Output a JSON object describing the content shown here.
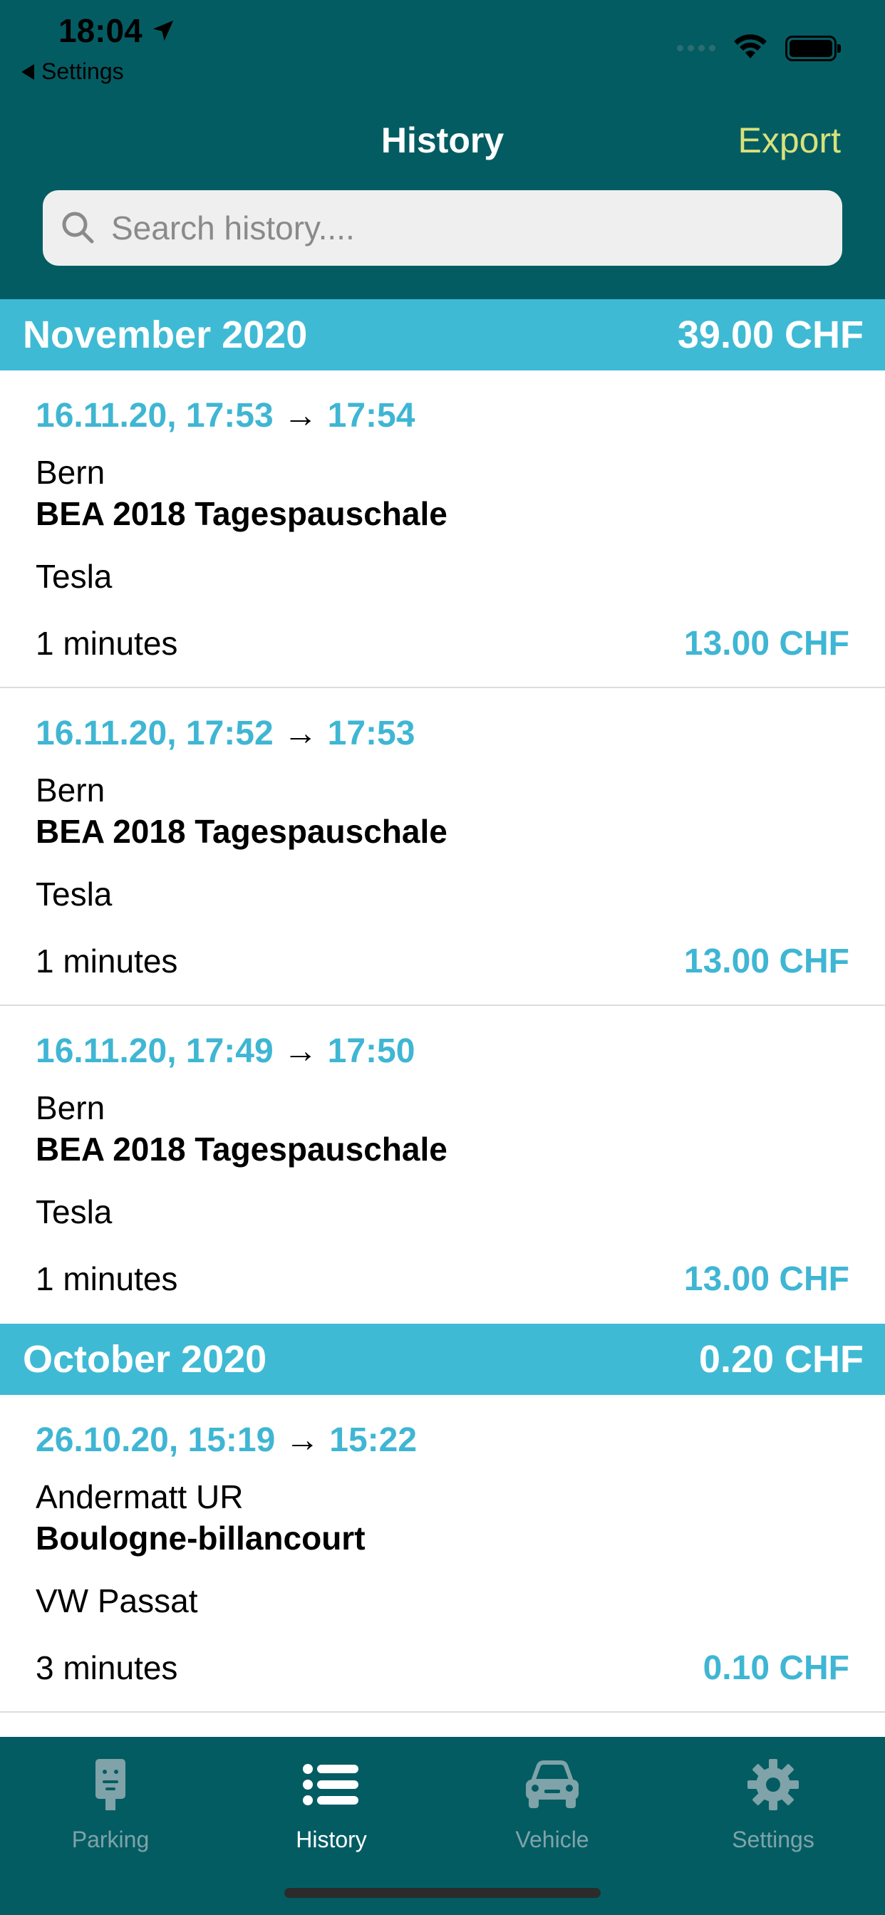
{
  "status": {
    "time": "18:04"
  },
  "back_link": {
    "label": "Settings"
  },
  "nav": {
    "title": "History",
    "export_label": "Export"
  },
  "search": {
    "placeholder": "Search history...."
  },
  "sections": [
    {
      "month": "November 2020",
      "total": "39.00 CHF",
      "entries": [
        {
          "start": "16.11.20, 17:53",
          "end": "17:54",
          "city": "Bern",
          "tariff": "BEA 2018 Tagespauschale",
          "vehicle": "Tesla",
          "duration": "1 minutes",
          "price": "13.00 CHF"
        },
        {
          "start": "16.11.20, 17:52",
          "end": "17:53",
          "city": "Bern",
          "tariff": "BEA 2018 Tagespauschale",
          "vehicle": "Tesla",
          "duration": "1 minutes",
          "price": "13.00 CHF"
        },
        {
          "start": "16.11.20, 17:49",
          "end": "17:50",
          "city": "Bern",
          "tariff": "BEA 2018 Tagespauschale",
          "vehicle": "Tesla",
          "duration": "1 minutes",
          "price": "13.00 CHF"
        }
      ]
    },
    {
      "month": "October 2020",
      "total": "0.20 CHF",
      "entries": [
        {
          "start": "26.10.20, 15:19",
          "end": "15:22",
          "city": "Andermatt UR",
          "tariff": "Boulogne-billancourt",
          "vehicle": "VW Passat",
          "duration": "3 minutes",
          "price": "0.10 CHF"
        }
      ]
    }
  ],
  "tabs": [
    {
      "label": "Parking",
      "icon": "parking-meter-icon",
      "active": false
    },
    {
      "label": "History",
      "icon": "list-icon",
      "active": true
    },
    {
      "label": "Vehicle",
      "icon": "car-icon",
      "active": false
    },
    {
      "label": "Settings",
      "icon": "gear-icon",
      "active": false
    }
  ],
  "colors": {
    "header_bg": "#045c63",
    "section_bg": "#3fbad4",
    "accent_text": "#3fb6d3",
    "export": "#d8e27a",
    "tab_inactive": "#7fa3a8"
  }
}
